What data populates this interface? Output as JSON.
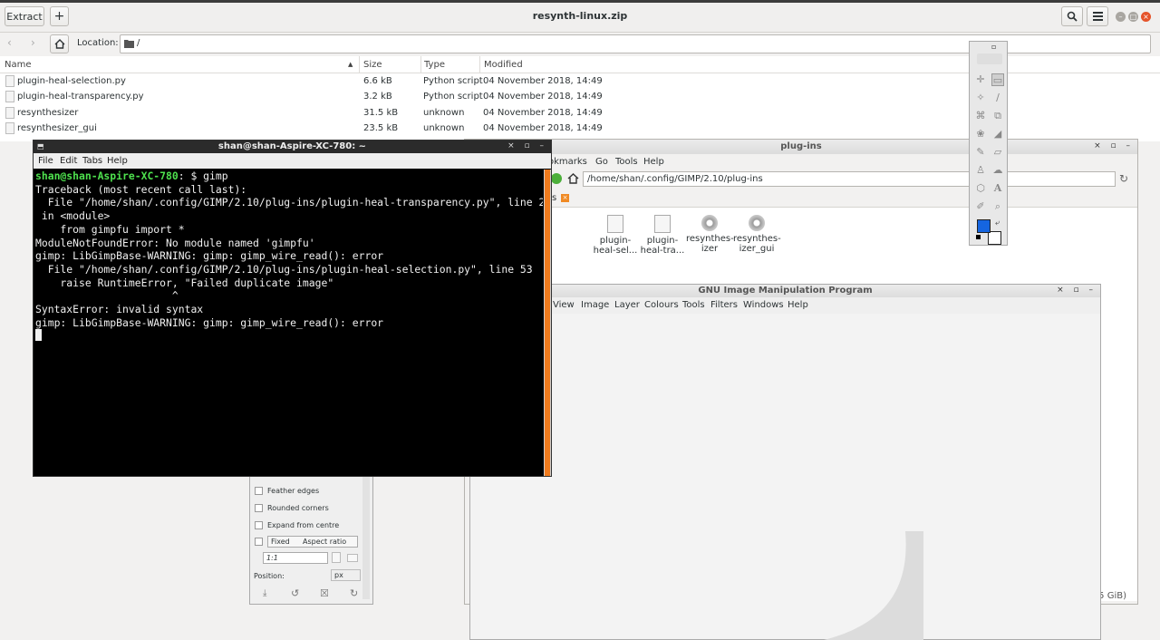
{
  "archive": {
    "title": "resynth-linux.zip",
    "extract_label": "Extract",
    "add_label": "+",
    "location_label": "Location:",
    "location_value": "/",
    "columns": [
      "Name",
      "Size",
      "Type",
      "Modified"
    ],
    "files": [
      {
        "name": "plugin-heal-selection.py",
        "size": "6.6 kB",
        "type": "Python script",
        "modified": "04 November 2018, 14:49"
      },
      {
        "name": "plugin-heal-transparency.py",
        "size": "3.2 kB",
        "type": "Python script",
        "modified": "04 November 2018, 14:49"
      },
      {
        "name": "resynthesizer",
        "size": "31.5 kB",
        "type": "unknown",
        "modified": "04 November 2018, 14:49"
      },
      {
        "name": "resynthesizer_gui",
        "size": "23.5 kB",
        "type": "unknown",
        "modified": "04 November 2018, 14:49"
      }
    ]
  },
  "filemanager": {
    "title": "plug-ins",
    "menu": [
      "okmarks",
      "Go",
      "Tools",
      "Help"
    ],
    "path": "/home/shan/.config/GIMP/2.10/plug-ins",
    "tab_label": "s",
    "items": [
      "plugin-heal-sel...",
      "plugin-heal-tra...",
      "resynthes-izer",
      "resynthes-izer_gui"
    ],
    "status": "5 GiB)"
  },
  "gimp": {
    "title": "GNU Image Manipulation Program",
    "menu": [
      "View",
      "Image",
      "Layer",
      "Colours",
      "Tools",
      "Filters",
      "Windows",
      "Help"
    ]
  },
  "tool_options": {
    "feather_edges": "Feather edges",
    "rounded_corners": "Rounded corners",
    "expand_from_centre": "Expand from centre",
    "fixed": "Fixed",
    "aspect_ratio": "Aspect ratio",
    "ratio_value": "1:1",
    "position_label": "Position:",
    "unit": "px"
  },
  "toolbox": {
    "fg_color": "#1565e0",
    "bg_color": "#ffffff"
  },
  "terminal": {
    "title": "shan@shan-Aspire-XC-780: ~",
    "menu": [
      "File",
      "Edit",
      "Tabs",
      "Help"
    ],
    "prompt": "shan@shan-Aspire-XC-780",
    "command": ": $ gimp",
    "output": [
      "Traceback (most recent call last):",
      "  File \"/home/shan/.config/GIMP/2.10/plug-ins/plugin-heal-transparency.py\", line 28,",
      " in <module>",
      "    from gimpfu import *",
      "ModuleNotFoundError: No module named 'gimpfu'",
      "gimp: LibGimpBase-WARNING: gimp: gimp_wire_read(): error",
      "  File \"/home/shan/.config/GIMP/2.10/plug-ins/plugin-heal-selection.py\", line 53",
      "    raise RuntimeError, \"Failed duplicate image\"",
      "                      ^",
      "SyntaxError: invalid syntax",
      "gimp: LibGimpBase-WARNING: gimp: gimp_wire_read(): error"
    ]
  }
}
